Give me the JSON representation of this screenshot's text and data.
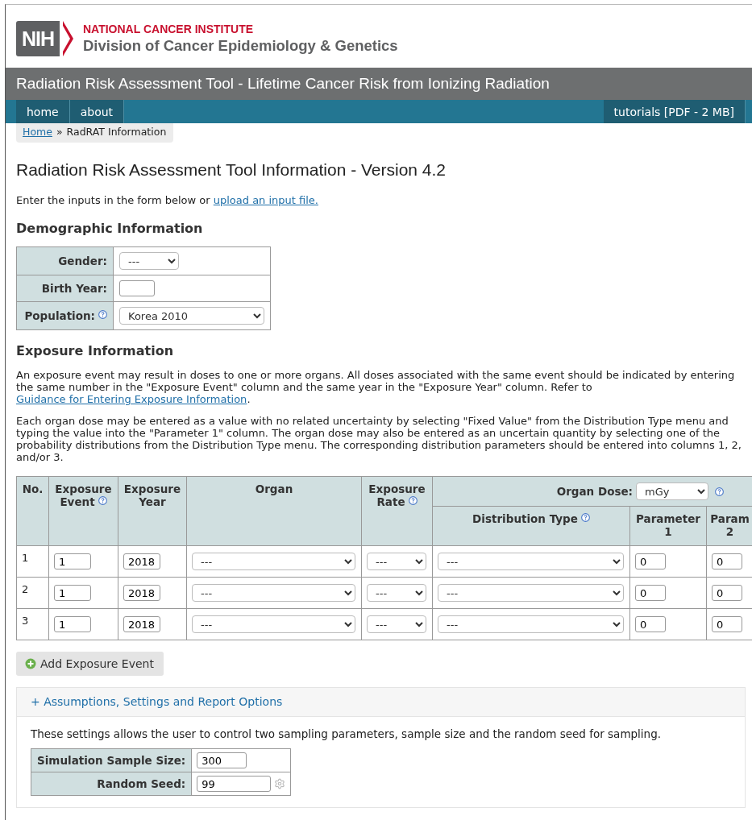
{
  "header": {
    "logo_text": "NIH",
    "org": "NATIONAL CANCER INSTITUTE",
    "division": "Division of Cancer Epidemiology & Genetics"
  },
  "title_bar": "Radiation Risk Assessment Tool - Lifetime Cancer Risk from Ionizing Radiation",
  "nav": {
    "left": [
      "home",
      "about"
    ],
    "right": [
      "tutorials [PDF - 2 MB]"
    ]
  },
  "breadcrumb": {
    "link": "Home",
    "separator": "»",
    "current": "RadRAT Information"
  },
  "heading": "Radiation Risk Assessment Tool Information - Version 4.2",
  "intro": {
    "text": "Enter the inputs in the form below or",
    "link": "upload an input file."
  },
  "demographic": {
    "title": "Demographic Information",
    "fields": [
      {
        "label": "Gender:",
        "kind": "select",
        "value": "---",
        "help": false
      },
      {
        "label": "Birth Year:",
        "kind": "input",
        "help": false
      },
      {
        "label": "Population:",
        "kind": "select",
        "value": "Korea 2010",
        "help": true
      }
    ]
  },
  "exposure": {
    "title": "Exposure Information",
    "paragraph_1": {
      "text": "An exposure event may result in doses to one or more organs. All doses associated with the same event should be indicated by entering the same number in the \"Exposure Event\" column and the same year in the \"Exposure Year\" column. Refer to",
      "link": "Guidance for Entering Exposure Information",
      "after": "."
    },
    "paragraph_2": "Each organ dose may be entered as a value with no related uncertainty by selecting \"Fixed Value\" from the Distribution Type menu and typing the value into the \"Parameter 1\" column. The organ dose may also be entered as an uncertain quantity by selecting one of the probability distributions from the Distribution Type menu. The corresponding distribution parameters should be entered into columns 1, 2, and/or 3.",
    "table": {
      "columns": [
        {
          "label": "No.",
          "help": false
        },
        {
          "label": "Exposure Event",
          "help": true
        },
        {
          "label": "Exposure Year",
          "help": false
        },
        {
          "label": "Organ",
          "help": false
        },
        {
          "label": "Exposure Rate",
          "help": true
        }
      ],
      "organ_dose": {
        "label": "Organ Dose:",
        "unit": "mGy",
        "help": true
      },
      "sub_columns": [
        {
          "label": "Distribution Type",
          "help": true
        },
        {
          "label": "Parameter 1",
          "help": false
        },
        {
          "label": "Param 2",
          "help": false
        }
      ],
      "rows": [
        {
          "no": "1",
          "event": "1",
          "year": "2018",
          "organ": "---",
          "rate": "---",
          "distribution": "---",
          "parameter_1": "0",
          "parameter_2": "0"
        },
        {
          "no": "2",
          "event": "1",
          "year": "2018",
          "organ": "---",
          "rate": "---",
          "distribution": "---",
          "parameter_1": "0",
          "parameter_2": "0"
        },
        {
          "no": "3",
          "event": "1",
          "year": "2018",
          "organ": "---",
          "rate": "---",
          "distribution": "---",
          "parameter_1": "0",
          "parameter_2": "0"
        }
      ]
    },
    "add_button": "Add Exposure Event"
  },
  "options": {
    "label": "+ Assumptions, Settings and Report Options",
    "expanded": true,
    "text": "These settings allows the user to control two sampling parameters, sample size and the random seed for sampling.",
    "fields": [
      {
        "label": "Simulation Sample Size:",
        "value": "300",
        "kind": "input"
      },
      {
        "label": "Random Seed:",
        "value": "99",
        "kind": "seed"
      }
    ]
  }
}
